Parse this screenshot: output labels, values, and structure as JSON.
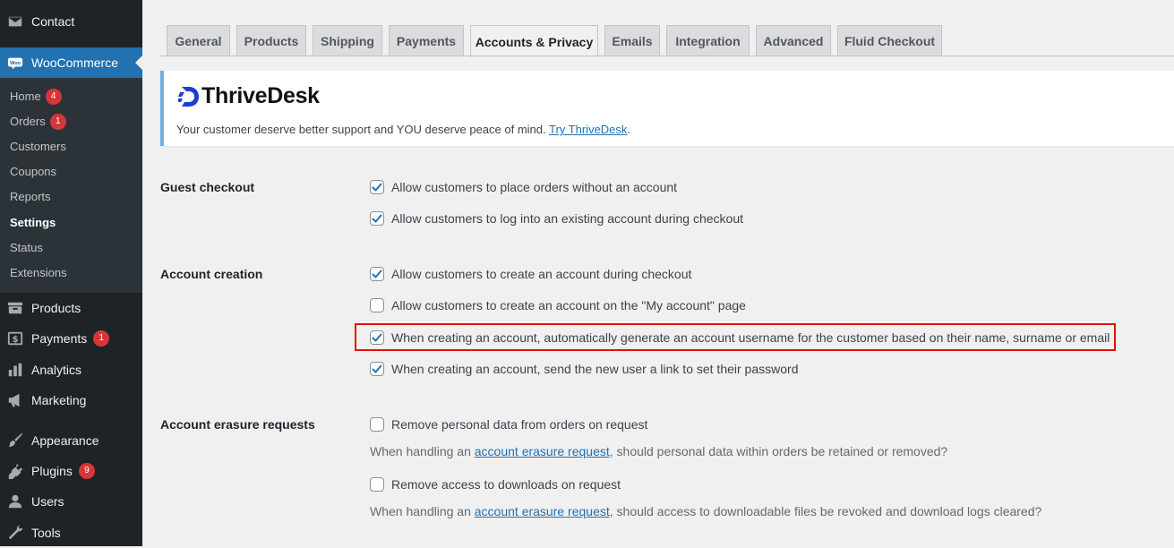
{
  "sidebar": {
    "top_items": [
      {
        "label": "Contact",
        "icon": "envelope-icon"
      },
      {
        "label": "WooCommerce",
        "icon": "woocommerce-icon"
      }
    ],
    "woo_submenu": [
      {
        "label": "Home",
        "badge": "4"
      },
      {
        "label": "Orders",
        "badge": "1"
      },
      {
        "label": "Customers"
      },
      {
        "label": "Coupons"
      },
      {
        "label": "Reports"
      },
      {
        "label": "Settings",
        "current": true
      },
      {
        "label": "Status"
      },
      {
        "label": "Extensions"
      }
    ],
    "bottom_items": [
      {
        "label": "Products",
        "icon": "archive-icon"
      },
      {
        "label": "Payments",
        "icon": "payments-icon",
        "badge": "1"
      },
      {
        "label": "Analytics",
        "icon": "bar-chart-icon"
      },
      {
        "label": "Marketing",
        "icon": "megaphone-icon"
      },
      {
        "label": "Appearance",
        "icon": "paintbrush-icon"
      },
      {
        "label": "Plugins",
        "icon": "plugin-icon",
        "badge": "9"
      },
      {
        "label": "Users",
        "icon": "users-icon"
      },
      {
        "label": "Tools",
        "icon": "wrench-icon"
      }
    ]
  },
  "tabs": [
    "General",
    "Products",
    "Shipping",
    "Payments",
    "Accounts & Privacy",
    "Emails",
    "Integration",
    "Advanced",
    "Fluid Checkout"
  ],
  "active_tab": "Accounts & Privacy",
  "notice": {
    "logo_text": "ThriveDesk",
    "text_before": "Your customer deserve better support and YOU deserve peace of mind.",
    "link": "Try ThriveDesk",
    "text_after": "."
  },
  "settings": {
    "guest_checkout": {
      "label": "Guest checkout",
      "options": [
        {
          "text": "Allow customers to place orders without an account",
          "checked": true
        },
        {
          "text": "Allow customers to log into an existing account during checkout",
          "checked": true
        }
      ]
    },
    "account_creation": {
      "label": "Account creation",
      "options": [
        {
          "text": "Allow customers to create an account during checkout",
          "checked": true
        },
        {
          "text": "Allow customers to create an account on the \"My account\" page",
          "checked": false
        },
        {
          "text": "When creating an account, automatically generate an account username for the customer based on their name, surname or email",
          "checked": true
        },
        {
          "text": "When creating an account, send the new user a link to set their password",
          "checked": true
        }
      ]
    },
    "account_erasure": {
      "label": "Account erasure requests",
      "option1": {
        "text": "Remove personal data from orders on request",
        "checked": false
      },
      "desc1": {
        "before": "When handling an",
        "link": "account erasure request",
        "after": ", should personal data within orders be retained or removed?"
      },
      "option2": {
        "text": "Remove access to downloads on request",
        "checked": false
      },
      "desc2": {
        "before": "When handling an",
        "link": "account erasure request",
        "after": ", should access to downloadable files be revoked and download logs cleared?"
      }
    }
  },
  "colors": {
    "sidebar_bg": "#1d2327",
    "active_menu": "#2271b1",
    "badge": "#d63638",
    "link": "#2271b1",
    "highlight_box": "#e3120b",
    "notice_border": "#72aee6"
  }
}
